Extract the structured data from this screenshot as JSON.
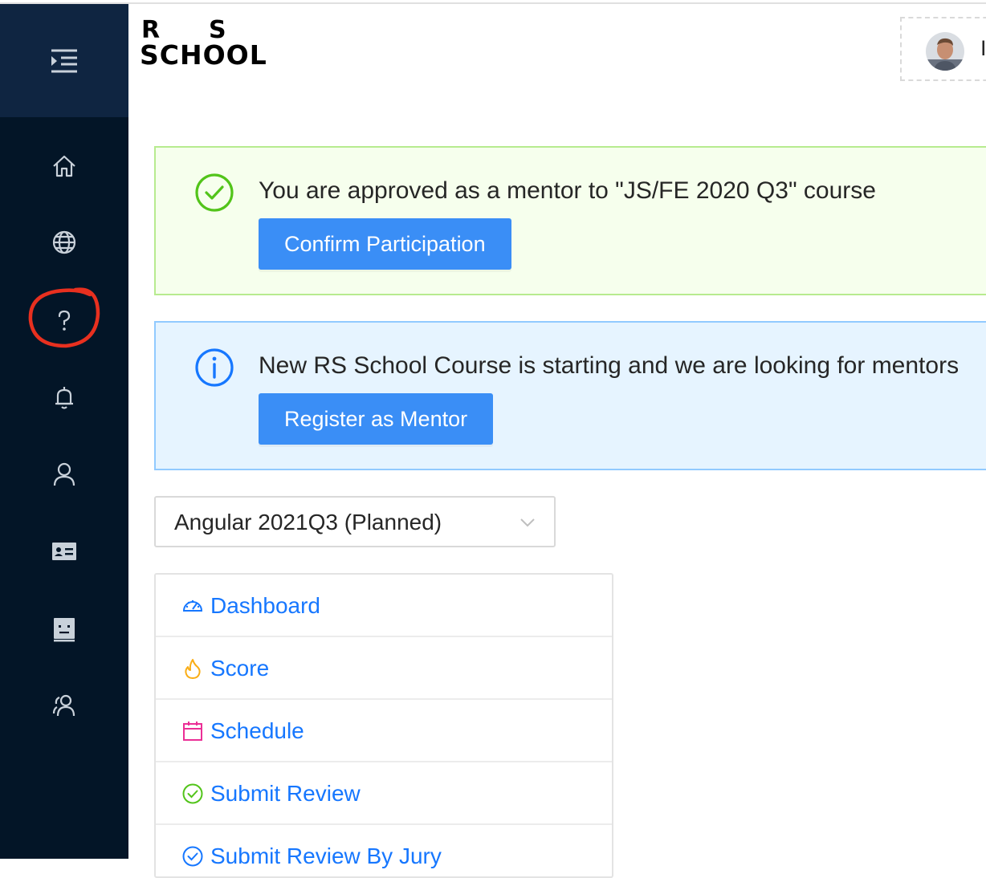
{
  "app": {
    "logo_text_top_left": "R",
    "logo_text_top_right": "S",
    "logo_text_bottom": "SCHOOL"
  },
  "sidebar": {
    "items": [
      {
        "icon": "menu-unfold-icon"
      },
      {
        "icon": "home-icon"
      },
      {
        "icon": "globe-icon"
      },
      {
        "icon": "question-icon",
        "highlighted": true
      },
      {
        "icon": "bell-icon"
      },
      {
        "icon": "user-icon"
      },
      {
        "icon": "id-card-icon"
      },
      {
        "icon": "robot-icon"
      },
      {
        "icon": "team-icon"
      }
    ]
  },
  "header": {
    "user_initial": "I"
  },
  "alerts": {
    "success": {
      "message": "You are approved as a mentor to \"JS/FE 2020 Q3\" course",
      "button": "Confirm Participation"
    },
    "info": {
      "message": "New RS School Course is starting and we are looking for mentors",
      "button": "Register as Mentor"
    }
  },
  "course_select": {
    "value": "Angular 2021Q3 (Planned)"
  },
  "menu": {
    "items": [
      {
        "label": "Dashboard",
        "icon": "dashboard-icon"
      },
      {
        "label": "Score",
        "icon": "fire-icon"
      },
      {
        "label": "Schedule",
        "icon": "calendar-icon"
      },
      {
        "label": "Submit Review",
        "icon": "check-circle-icon"
      },
      {
        "label": "Submit Review By Jury",
        "icon": "check-circle-icon"
      }
    ]
  },
  "colors": {
    "sidebar_bg": "#031527",
    "sidebar_top_bg": "#0f2541",
    "primary": "#3a8ef6",
    "link": "#1677ff",
    "success_bg": "#f6ffed",
    "info_bg": "#e6f4ff",
    "annotation": "#e8301f"
  }
}
